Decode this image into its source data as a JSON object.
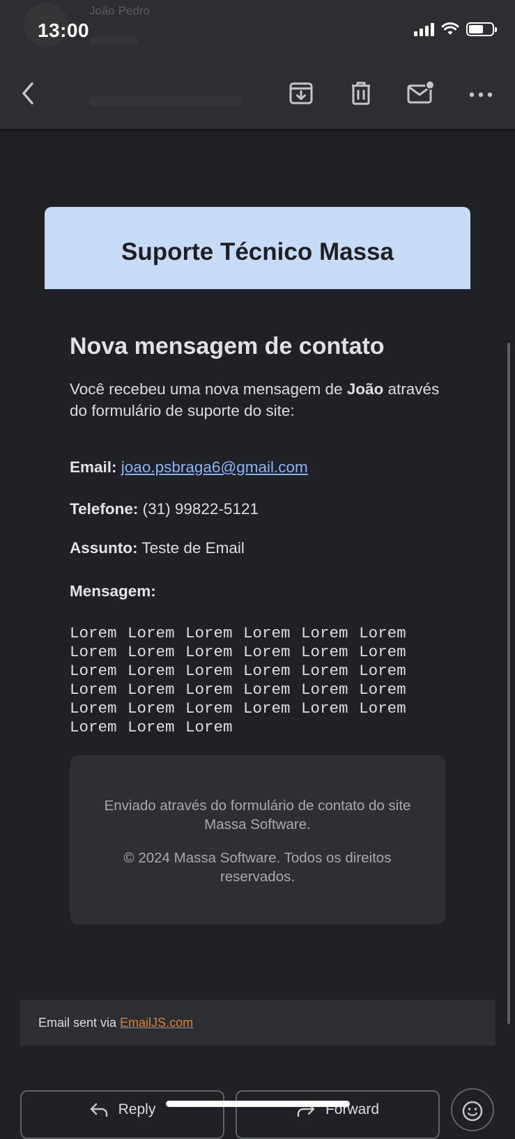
{
  "status_bar": {
    "time": "13:00"
  },
  "header": {
    "ghost_sender": "João Pedro",
    "actions": [
      "back",
      "archive",
      "delete",
      "mark-unread",
      "more"
    ]
  },
  "email": {
    "brand_title": "Suporte Técnico Massa",
    "heading": "Nova mensagem de contato",
    "intro_prefix": "Você recebeu uma nova mensagem de ",
    "sender_name": "João",
    "intro_suffix": " através do formulário de suporte do site:",
    "email_label": "Email:",
    "email_value": "joao.psbraga6@gmail.com",
    "phone_label": "Telefone:",
    "phone_value": "(31) 99822-5121",
    "subject_label": "Assunto:",
    "subject_value": "Teste de Email",
    "message_label": "Mensagem:",
    "message_body": "Lorem Lorem Lorem Lorem Lorem Lorem Lorem Lorem Lorem Lorem Lorem Lorem Lorem Lorem Lorem Lorem Lorem Lorem Lorem Lorem Lorem Lorem Lorem Lorem Lorem Lorem Lorem Lorem Lorem Lorem Lorem Lorem Lorem",
    "footer_line1": "Enviado através do formulário de contato do site Massa Software.",
    "footer_line2": "© 2024 Massa Software. Todos os direitos reservados."
  },
  "emailjs_notice": {
    "prefix": "Email sent via",
    "link_text": "EmailJS.com"
  },
  "bottom_actions": {
    "reply_label": "Reply",
    "forward_label": "Forward"
  },
  "colors": {
    "background": "#202124",
    "toolbar": "#2d2e31",
    "brand_header": "#c5dbf6",
    "link": "#8ab4f8",
    "emailjs_link": "#d4843a"
  }
}
